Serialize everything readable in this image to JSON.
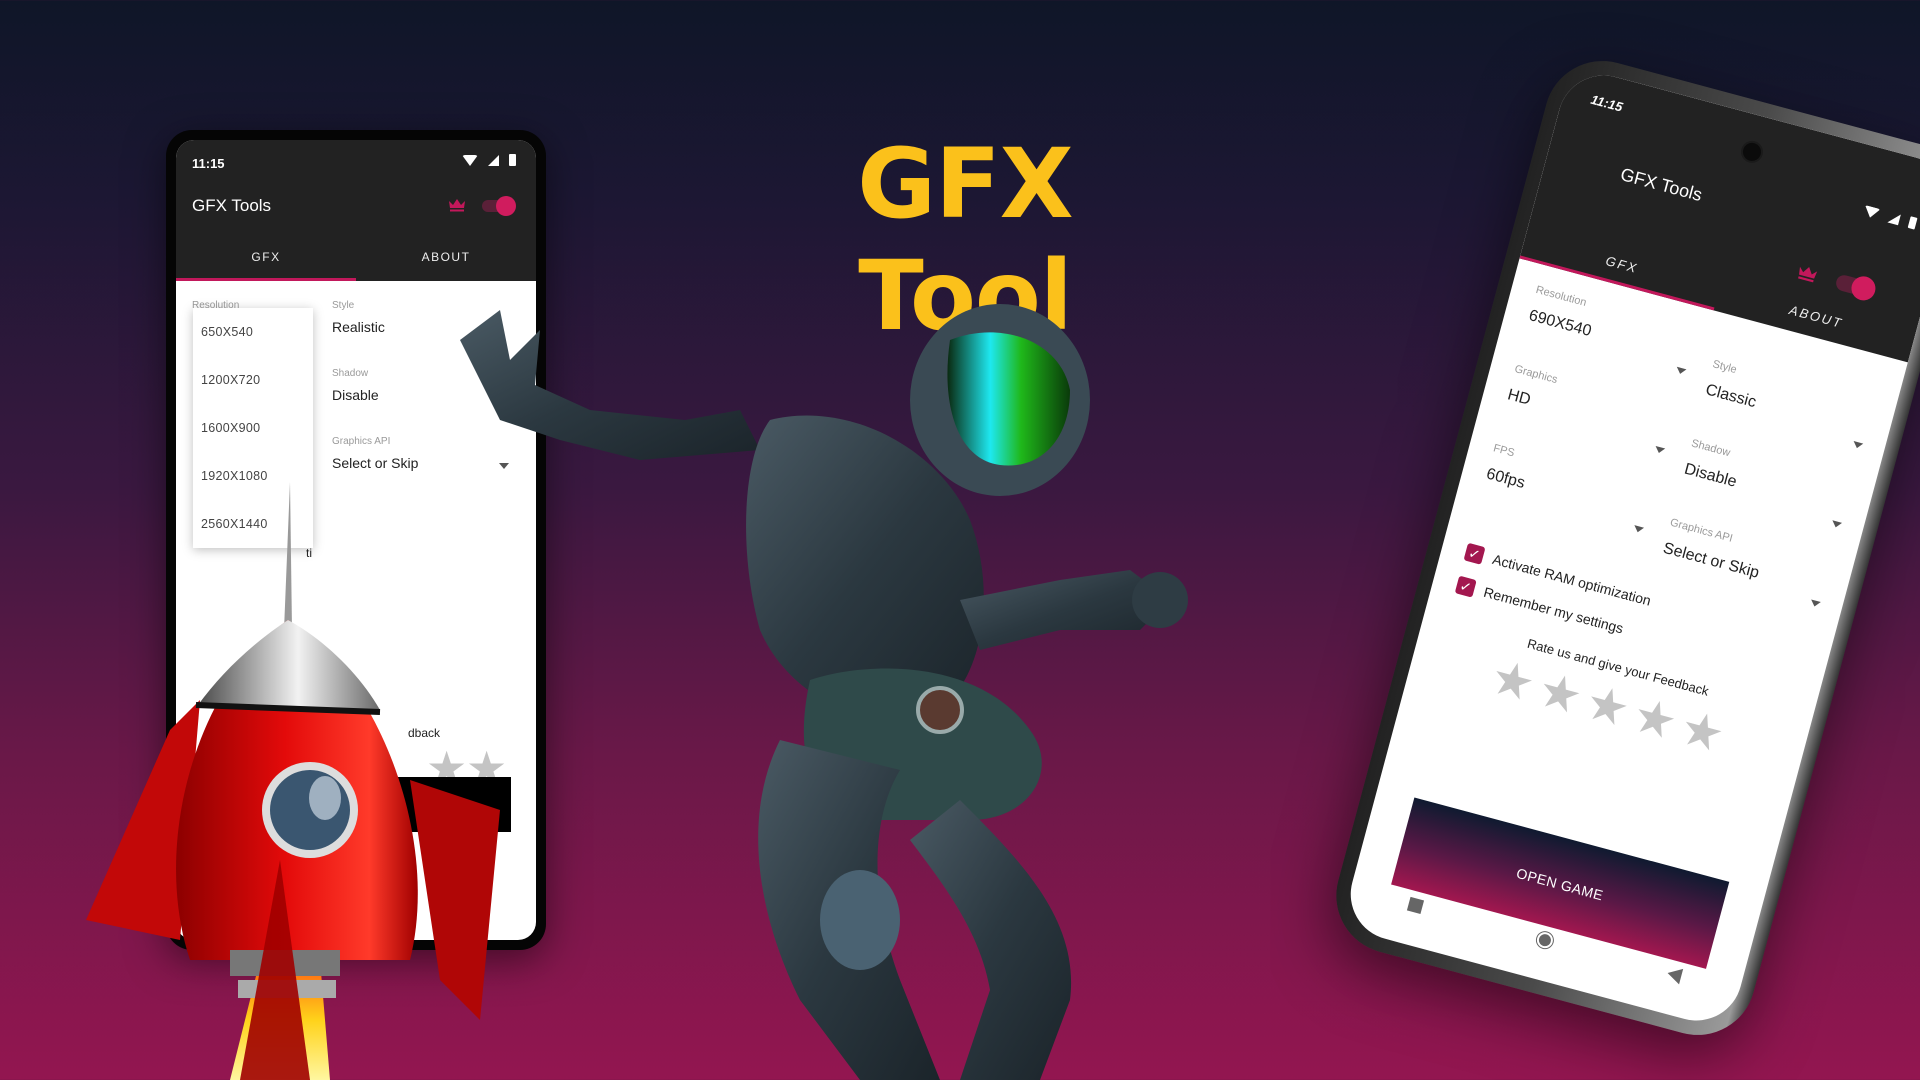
{
  "hero": {
    "title": "GFX Tool"
  },
  "colors": {
    "accent": "#c2185b",
    "title_yellow": "#fbc11b",
    "appbar": "#222222",
    "checkbox": "#a3174f",
    "star_gray": "#c4c4c4"
  },
  "left_phone": {
    "status": {
      "time": "11:15",
      "icons": [
        "wifi-icon",
        "signal-icon",
        "battery-icon"
      ]
    },
    "app_title": "GFX Tools",
    "toolbar_icons": [
      "crown-icon",
      "toggle-switch"
    ],
    "toggle_on": true,
    "tabs": [
      {
        "label": "GFX",
        "active": true
      },
      {
        "label": "ABOUT",
        "active": false
      }
    ],
    "fields": {
      "resolution": {
        "label": "Resolution"
      },
      "style": {
        "label": "Style",
        "value": "Realistic"
      },
      "shadow": {
        "label": "Shadow",
        "value": "Disable"
      },
      "graphics_api": {
        "label": "Graphics API",
        "value": "Select or Skip"
      }
    },
    "resolution_dropdown": {
      "open": true,
      "options": [
        "650X540",
        "1200X720",
        "1600X900",
        "1920X1080",
        "2560X1440"
      ]
    },
    "partial_text": {
      "settings_fragment": "ti",
      "feedback_fragment": "dback"
    },
    "star_rating": {
      "value": 0,
      "max": 5
    }
  },
  "right_phone": {
    "status": {
      "time": "11:15",
      "icons": [
        "wifi-icon",
        "signal-icon",
        "battery-icon"
      ]
    },
    "app_title": "GFX Tools",
    "toolbar_icons": [
      "crown-icon",
      "toggle-switch"
    ],
    "toggle_on": true,
    "tabs": [
      {
        "label": "GFX",
        "active": true
      },
      {
        "label": "ABOUT",
        "active": false
      }
    ],
    "fields_left": [
      {
        "label": "Resolution",
        "value": "690X540"
      },
      {
        "label": "Graphics",
        "value": "HD"
      },
      {
        "label": "FPS",
        "value": "60fps"
      }
    ],
    "fields_right": [
      {
        "label": "Style",
        "value": "Classic"
      },
      {
        "label": "Shadow",
        "value": "Disable"
      },
      {
        "label": "Graphics API",
        "value": "Select or Skip"
      }
    ],
    "checkboxes": [
      {
        "label": "Activate RAM optimization",
        "checked": true
      },
      {
        "label": "Remember my settings",
        "checked": true
      }
    ],
    "rating_prompt": "Rate us and give your Feedback",
    "star_rating": {
      "value": 0,
      "max": 5
    },
    "open_game_label": "OPEN GAME",
    "nav_buttons": [
      "recents-icon",
      "home-icon",
      "back-icon"
    ]
  },
  "illustrations": [
    "rocket",
    "astronaut"
  ]
}
